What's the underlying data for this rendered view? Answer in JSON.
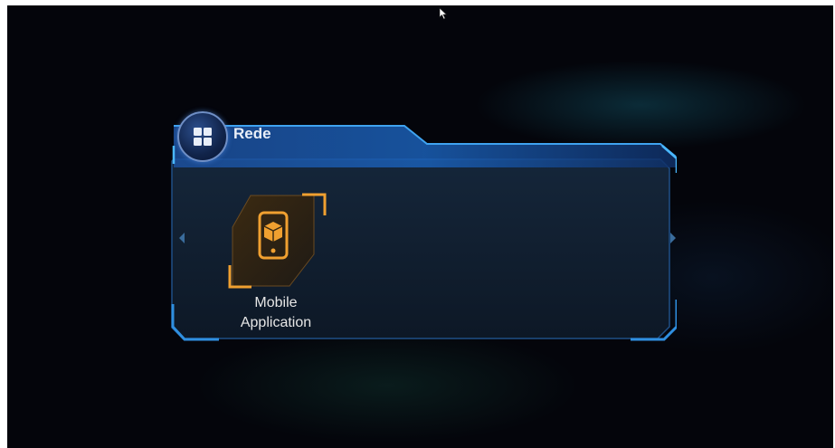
{
  "menu": {
    "title": "Rede",
    "items": [
      {
        "label_line1": "Mobile",
        "label_line2": "Application",
        "icon": "mobile-app-icon",
        "selected": true
      }
    ]
  },
  "icons": {
    "title_icon": "grid-menu-icon",
    "nav_left": "chevron-left-icon",
    "nav_right": "chevron-right-icon"
  },
  "colors": {
    "accent": "#2f8fe0",
    "selection": "#f0a030",
    "background": "#04050b"
  }
}
